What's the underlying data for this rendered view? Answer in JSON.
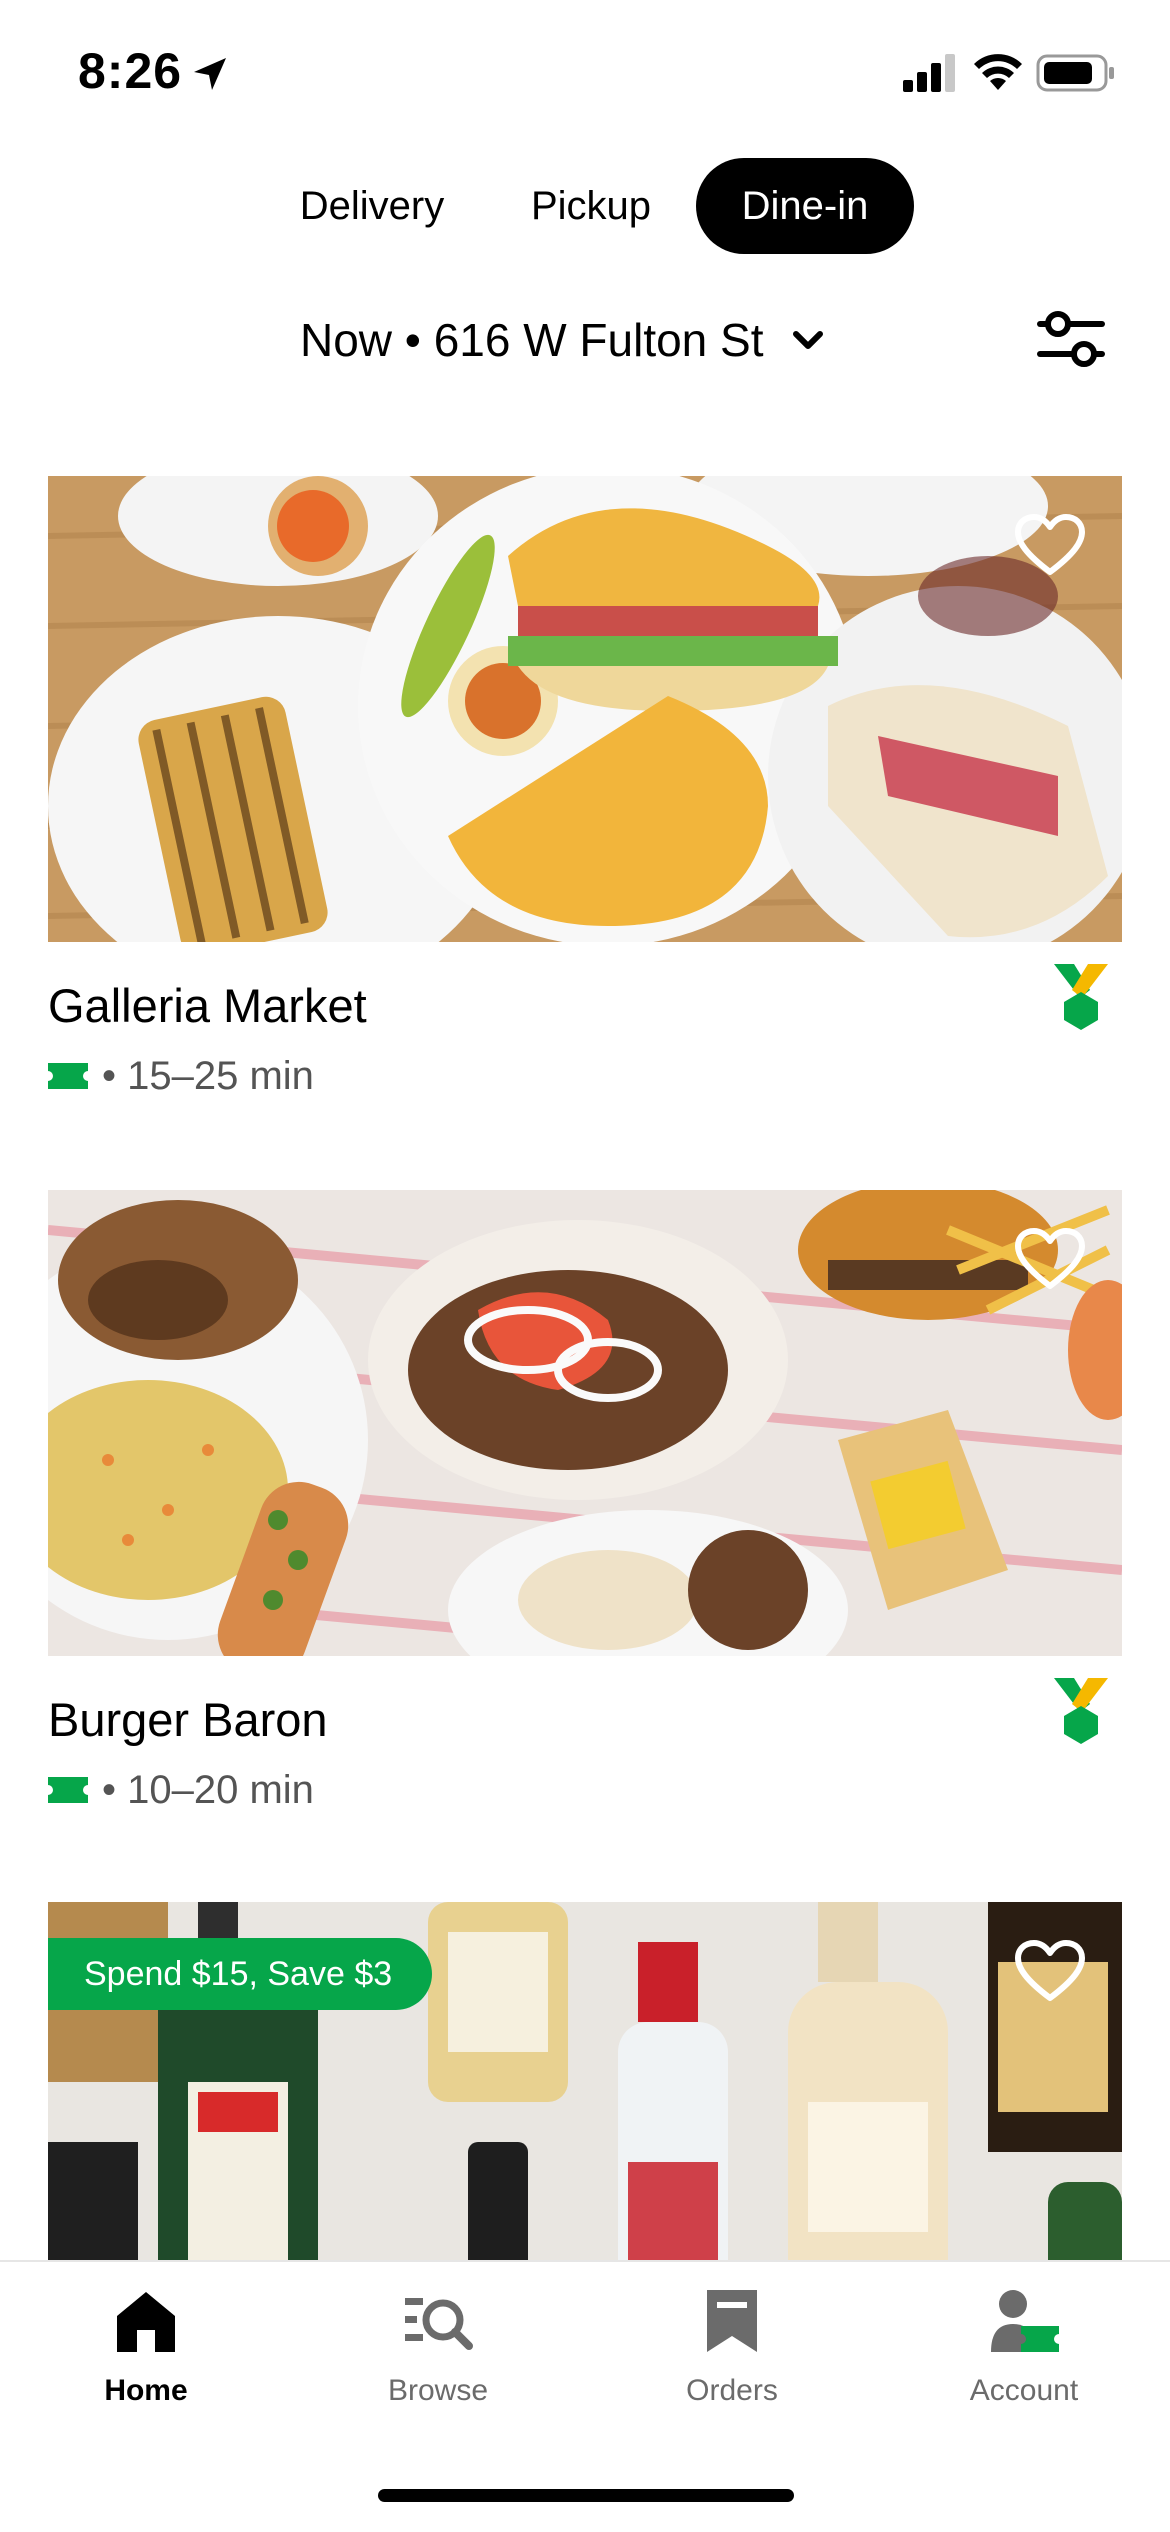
{
  "status_bar": {
    "time": "8:26"
  },
  "mode_tabs": [
    {
      "label": "Delivery",
      "selected": false
    },
    {
      "label": "Pickup",
      "selected": false
    },
    {
      "label": "Dine-in",
      "selected": true
    }
  ],
  "address": {
    "text": "Now • 616 W Fulton St"
  },
  "stores": [
    {
      "name": "Galleria Market",
      "eta": "• 15–25 min",
      "favorite": false
    },
    {
      "name": "Burger Baron",
      "eta": "• 10–20 min",
      "favorite": false
    },
    {
      "promo": "Spend $15, Save $3",
      "favorite": false
    }
  ],
  "bottom_nav": [
    {
      "label": "Home",
      "icon": "home-icon",
      "active": true
    },
    {
      "label": "Browse",
      "icon": "browse-icon",
      "active": false
    },
    {
      "label": "Orders",
      "icon": "orders-icon",
      "active": false
    },
    {
      "label": "Account",
      "icon": "account-icon",
      "active": false
    }
  ],
  "colors": {
    "accent_green": "#06a64a",
    "badge_yellow": "#f5b800",
    "text_secondary": "#545454"
  }
}
